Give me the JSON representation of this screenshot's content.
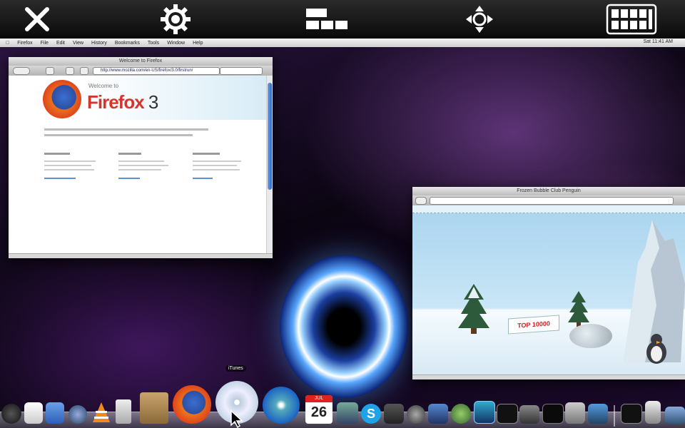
{
  "menubar": {
    "items": [
      "Firefox",
      "File",
      "Edit",
      "View",
      "History",
      "Bookmarks",
      "Tools",
      "Window",
      "Help"
    ],
    "right": "Sat 11:41 AM"
  },
  "firefox_window": {
    "title": "Welcome to Firefox",
    "url": "http://www.mozilla.com/en-US/firefox/3.0/firstrun/",
    "logo_small": "Welcome to",
    "logo_big": "Firefox",
    "logo_num": "3"
  },
  "game_window": {
    "title": "Frozen Bubble Club Penguin",
    "score_sign": "TOP 10000"
  },
  "dock": {
    "ical_day": "26",
    "ical_month": "JUL",
    "tooltip": "iTunes"
  },
  "colors": {
    "toolbar_icon": "#ffffff",
    "firefox_red": "#d6352b",
    "portal_blue": "#5aa8ff"
  }
}
